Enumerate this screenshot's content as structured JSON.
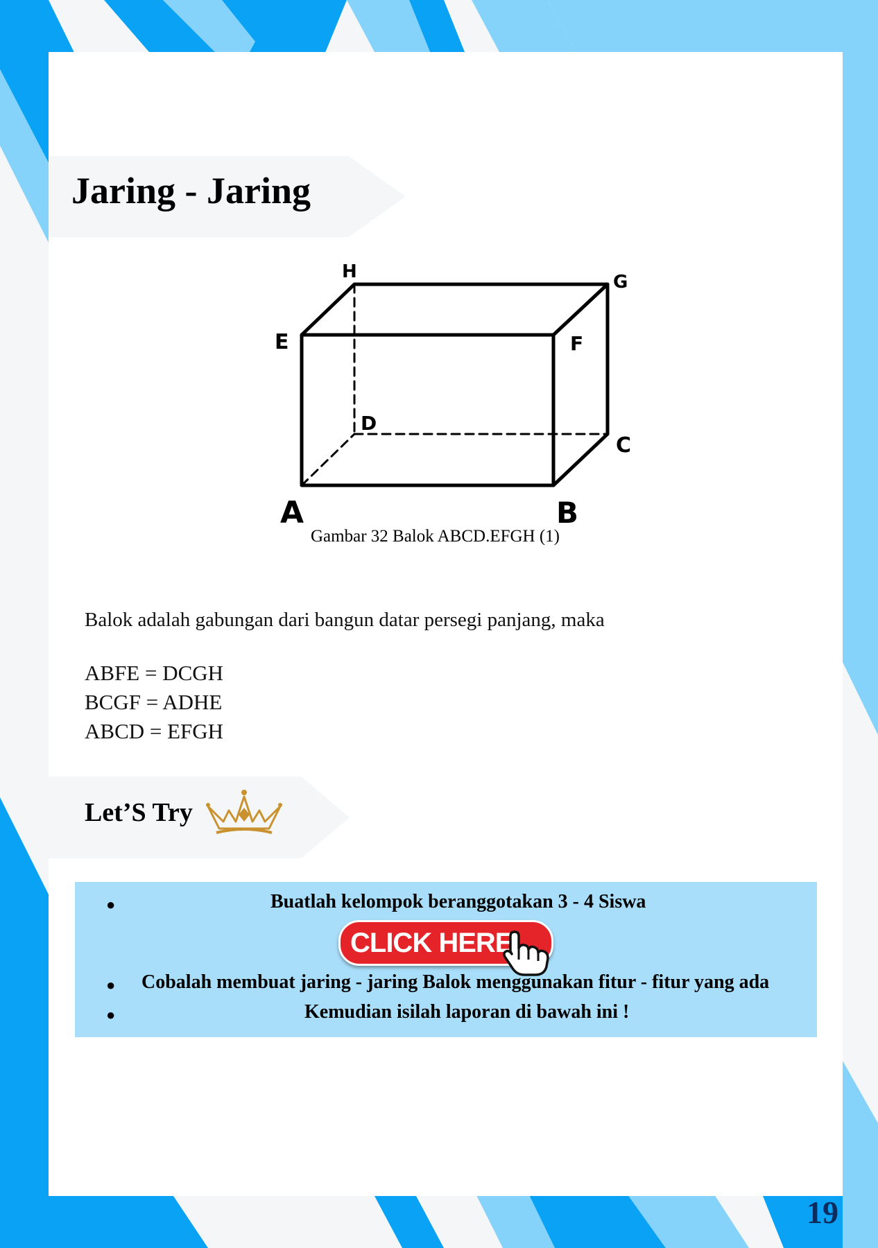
{
  "colors": {
    "accent_blue": "#0aa2f5",
    "light_blue": "#85d3fb",
    "box_blue": "#a8defa",
    "button_red": "#e5242a",
    "page_number": "#0c2c5e",
    "crown_gold": "#c9922e"
  },
  "header": {
    "title": "Jaring - Jaring"
  },
  "figure": {
    "vertex_labels": {
      "A": "A",
      "B": "B",
      "C": "C",
      "D": "D",
      "E": "E",
      "F": "F",
      "G": "G",
      "H": "H"
    },
    "caption": "Gambar 32 Balok ABCD.EFGH (1)"
  },
  "body": {
    "intro": "Balok adalah gabungan dari bangun datar persegi panjang, maka",
    "equations": [
      "ABFE = DCGH",
      "BCGF = ADHE",
      "ABCD = EFGH"
    ]
  },
  "activity": {
    "heading": "Let’S Try",
    "crown_icon": "crown-icon",
    "bullets": [
      "Buatlah kelompok beranggotakan  3 - 4 Siswa",
      "Cobalah membuat jaring - jaring Balok menggunakan fitur - fitur yang ada",
      "Kemudian isilah laporan di bawah ini !"
    ],
    "button_label": "CLICK HERE",
    "button_icon": "pointer-hand-icon"
  },
  "footer": {
    "page_number": "19"
  }
}
